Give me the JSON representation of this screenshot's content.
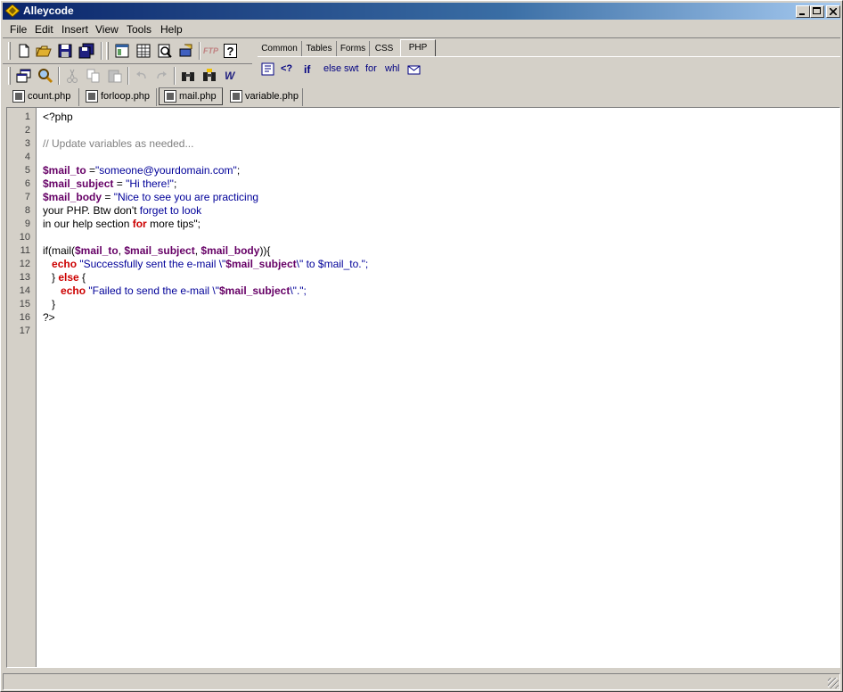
{
  "app": {
    "title": "Alleycode"
  },
  "menu": [
    "File",
    "Edit",
    "Insert",
    "View",
    "Tools",
    "Help"
  ],
  "toolbar": {
    "row1": [
      "new-file-icon",
      "open-folder-icon",
      "save-icon",
      "save-all-icon",
      "frame-icon",
      "table-icon",
      "preview-icon",
      "wizard-icon",
      "ftp-icon",
      "help-icon"
    ],
    "ftp_label": "FTP",
    "help_label": "?",
    "row2": [
      "window-icon",
      "find-icon",
      "cut-icon",
      "copy-icon",
      "paste-icon",
      "undo-icon",
      "redo-icon",
      "binoculars-icon",
      "find-replace-icon",
      "word-icon"
    ]
  },
  "tag_panel": {
    "tabs": [
      "Common",
      "Tables",
      "Forms",
      "CSS",
      "PHP"
    ],
    "active_tab": "PHP",
    "php_items": [
      "<?",
      "if",
      "else",
      "swt",
      "for",
      "whl"
    ]
  },
  "file_tabs": [
    {
      "label": "count.php",
      "active": false
    },
    {
      "label": "forloop.php",
      "active": false
    },
    {
      "label": "mail.php",
      "active": true
    },
    {
      "label": "variable.php",
      "active": false
    }
  ],
  "editor": {
    "line_numbers": [
      "1",
      "2",
      "3",
      "4",
      "5",
      "6",
      "7",
      "8",
      "9",
      "10",
      "11",
      "12",
      "13",
      "14",
      "15",
      "16",
      "17"
    ],
    "lines": [
      [
        {
          "t": "<?php",
          "c": ""
        }
      ],
      [],
      [
        {
          "t": "// Update variables as needed...",
          "c": "c-comment"
        }
      ],
      [],
      [
        {
          "t": "$mail_to",
          "c": "c-var"
        },
        {
          "t": " =",
          "c": ""
        },
        {
          "t": "\"someone@yourdomain.com\"",
          "c": "c-str"
        },
        {
          "t": ";",
          "c": ""
        }
      ],
      [
        {
          "t": "$mail_subject",
          "c": "c-var"
        },
        {
          "t": " = ",
          "c": ""
        },
        {
          "t": "\"Hi there!\"",
          "c": "c-str"
        },
        {
          "t": ";",
          "c": ""
        }
      ],
      [
        {
          "t": "$mail_body",
          "c": "c-var"
        },
        {
          "t": " = ",
          "c": ""
        },
        {
          "t": "\"Nice to see you are practicing",
          "c": "c-str"
        }
      ],
      [
        {
          "t": "your PHP. Btw don't ",
          "c": ""
        },
        {
          "t": "forget to look",
          "c": "c-str"
        }
      ],
      [
        {
          "t": "in our help section ",
          "c": ""
        },
        {
          "t": "for",
          "c": "c-kw"
        },
        {
          "t": " more tips\";",
          "c": ""
        }
      ],
      [],
      [
        {
          "t": "if(mail(",
          "c": ""
        },
        {
          "t": "$mail_to",
          "c": "c-var"
        },
        {
          "t": ", ",
          "c": ""
        },
        {
          "t": "$mail_subject",
          "c": "c-var"
        },
        {
          "t": ", ",
          "c": ""
        },
        {
          "t": "$mail_body",
          "c": "c-var"
        },
        {
          "t": ")){",
          "c": ""
        }
      ],
      [
        {
          "t": "   ",
          "c": ""
        },
        {
          "t": "echo",
          "c": "c-kw"
        },
        {
          "t": " \"Successfully sent the e-mail \\\"",
          "c": "c-str"
        },
        {
          "t": "$mail_subject",
          "c": "c-var"
        },
        {
          "t": "\\\" to $mail_to.\";",
          "c": "c-str"
        }
      ],
      [
        {
          "t": "   } ",
          "c": ""
        },
        {
          "t": "else",
          "c": "c-kw"
        },
        {
          "t": " {",
          "c": ""
        }
      ],
      [
        {
          "t": "      ",
          "c": ""
        },
        {
          "t": "echo",
          "c": "c-kw"
        },
        {
          "t": " \"Failed to send the e-mail \\\"",
          "c": "c-str"
        },
        {
          "t": "$mail_subject",
          "c": "c-var"
        },
        {
          "t": "\\\".\";",
          "c": "c-str"
        }
      ],
      [
        {
          "t": "   }",
          "c": ""
        }
      ],
      [
        {
          "t": "?>",
          "c": ""
        }
      ],
      []
    ]
  },
  "colors": {
    "titlebar_start": "#0a246a",
    "titlebar_end": "#a6caf0",
    "chrome": "#d4d0c8"
  }
}
